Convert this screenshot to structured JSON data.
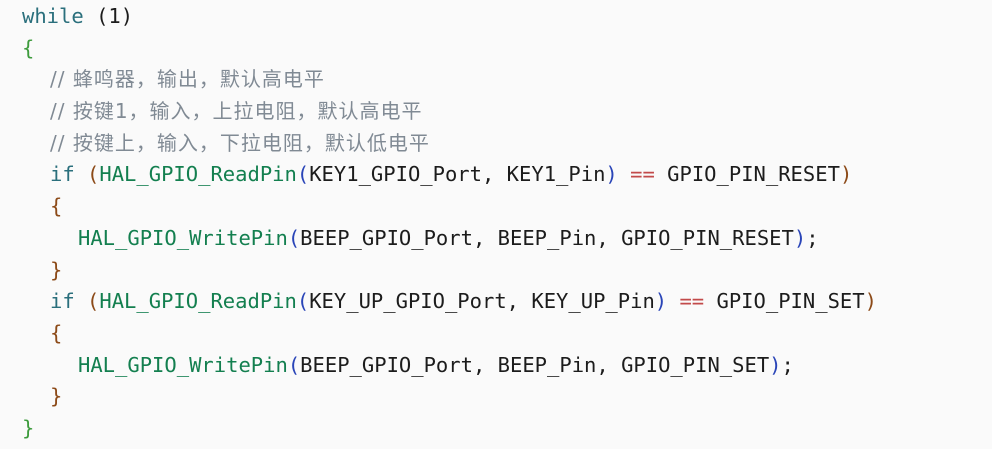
{
  "code": {
    "while_kw": "while",
    "while_cond": "(1)",
    "brace_open_outer": "{",
    "comments": [
      "// 蜂鸣器，输出，默认高电平",
      "// 按键1，输入，上拉电阻，默认高电平",
      "// 按键上，输入，下拉电阻，默认低电平"
    ],
    "if1": {
      "kw": "if",
      "paren_open": "(",
      "fn": "HAL_GPIO_ReadPin",
      "call_open": "(",
      "args": "KEY1_GPIO_Port, KEY1_Pin",
      "call_close": ")",
      "op": "==",
      "value": "GPIO_PIN_RESET",
      "paren_close": ")",
      "brace_open": "{",
      "body_fn": "HAL_GPIO_WritePin",
      "body_open": "(",
      "body_args": "BEEP_GPIO_Port, BEEP_Pin, GPIO_PIN_RESET",
      "body_close": ")",
      "semicolon": ";",
      "brace_close": "}"
    },
    "if2": {
      "kw": "if",
      "paren_open": "(",
      "fn": "HAL_GPIO_ReadPin",
      "call_open": "(",
      "args": "KEY_UP_GPIO_Port, KEY_UP_Pin",
      "call_close": ")",
      "op": "==",
      "value": "GPIO_PIN_SET",
      "paren_close": ")",
      "brace_open": "{",
      "body_fn": "HAL_GPIO_WritePin",
      "body_open": "(",
      "body_args": "BEEP_GPIO_Port, BEEP_Pin, GPIO_PIN_SET",
      "body_close": ")",
      "semicolon": ";",
      "brace_close": "}"
    },
    "brace_close_outer": "}"
  },
  "colors": {
    "background": "#fafafa",
    "keyword": "#2a6f7c",
    "function": "#137f4f",
    "comment": "#808a94",
    "outer_brace": "#3d9b3c",
    "inner_brace": "#8c4a18",
    "call_paren": "#2a45b8",
    "operator": "#c24a4a"
  }
}
